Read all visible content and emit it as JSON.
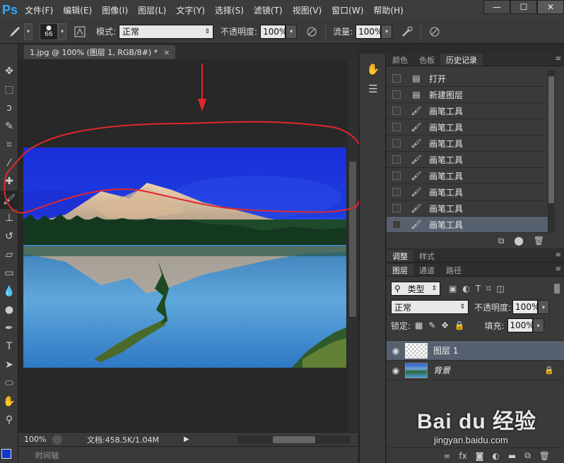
{
  "app": {
    "logo": "Ps"
  },
  "menu": [
    "文件(F)",
    "编辑(E)",
    "图像(I)",
    "图层(L)",
    "文字(Y)",
    "选择(S)",
    "滤镜(T)",
    "视图(V)",
    "窗口(W)",
    "帮助(H)"
  ],
  "window_controls": {
    "minimize": "—",
    "maximize": "☐",
    "close": "✕"
  },
  "options": {
    "brush_size": "66",
    "mode_label": "模式:",
    "mode_value": "正常",
    "opacity_label": "不透明度:",
    "opacity_value": "100%",
    "flow_label": "流量:",
    "flow_value": "100%"
  },
  "document": {
    "tab_title": "1.jpg @ 100% (图层 1, RGB/8#) *",
    "tab_close": "×",
    "zoom": "100%",
    "doc_info": "文档:458.5K/1.04M",
    "timeline_label": "时间轴"
  },
  "history_panel": {
    "tabs": [
      "颜色",
      "色板",
      "历史记录"
    ],
    "active_tab": 2,
    "items": [
      {
        "label": "打开",
        "icon": "document-icon"
      },
      {
        "label": "新建图层",
        "icon": "document-icon"
      },
      {
        "label": "画笔工具",
        "icon": "brush-icon"
      },
      {
        "label": "画笔工具",
        "icon": "brush-icon"
      },
      {
        "label": "画笔工具",
        "icon": "brush-icon"
      },
      {
        "label": "画笔工具",
        "icon": "brush-icon"
      },
      {
        "label": "画笔工具",
        "icon": "brush-icon"
      },
      {
        "label": "画笔工具",
        "icon": "brush-icon"
      },
      {
        "label": "画笔工具",
        "icon": "brush-icon"
      },
      {
        "label": "画笔工具",
        "icon": "brush-icon"
      }
    ],
    "active_index": 9
  },
  "adjust_panel": {
    "tabs": [
      "调整",
      "样式"
    ]
  },
  "layers_panel": {
    "tabs": [
      "图层",
      "通道",
      "路径"
    ],
    "filter_label": "类型",
    "blend_mode": "正常",
    "opacity_label": "不透明度:",
    "opacity_value": "100%",
    "lock_label": "锁定:",
    "fill_label": "填充:",
    "fill_value": "100%",
    "layers": [
      {
        "name": "图层 1",
        "type": "transparent"
      },
      {
        "name": "背景",
        "type": "photo",
        "locked": true
      }
    ]
  },
  "watermark": {
    "main": "Bai du 经验",
    "sub": "jingyan.baidu.com"
  },
  "colors": {
    "foreground": "#1437c8",
    "accent": "#30a8ff",
    "annotation": "#e0282e"
  }
}
